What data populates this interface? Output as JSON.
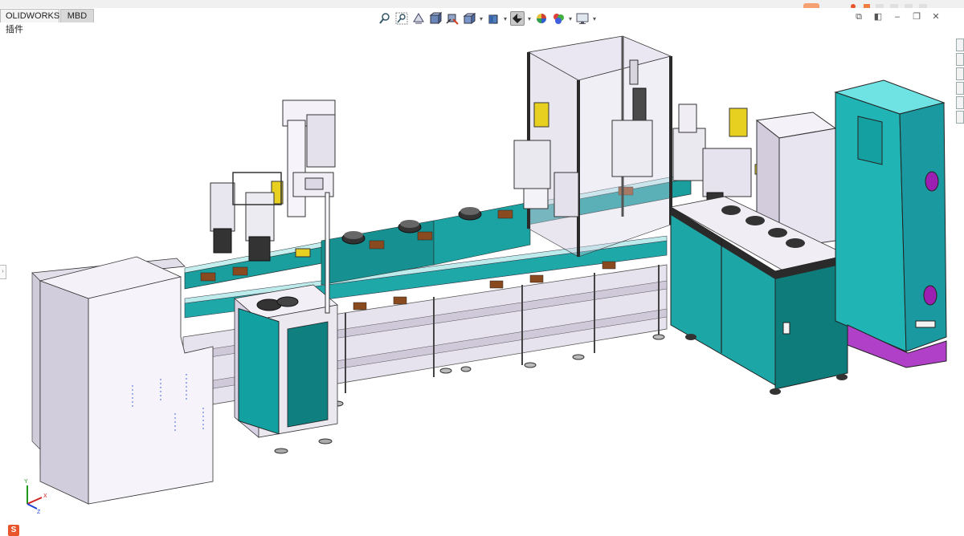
{
  "tabs": [
    {
      "label": "OLIDWORKS 插件",
      "active": false
    },
    {
      "label": "MBD",
      "active": true
    }
  ],
  "hud_toolbar": {
    "items": [
      {
        "icon": "zoom-to-fit-icon"
      },
      {
        "icon": "zoom-to-area-icon"
      },
      {
        "icon": "previous-view-icon"
      },
      {
        "icon": "section-view-icon"
      },
      {
        "icon": "dynamic-annotation-icon"
      },
      {
        "icon": "view-orientation-icon"
      },
      {
        "icon": "display-style-icon",
        "pressed": true
      },
      {
        "icon": "hide-show-items-icon"
      },
      {
        "icon": "edit-appearance-icon"
      },
      {
        "icon": "apply-scene-icon"
      },
      {
        "icon": "view-settings-icon"
      }
    ]
  },
  "colors": {
    "accent_teal": "#18a8a8",
    "frame_lavender": "#d8d2e4",
    "panel_white": "#f2f0f6",
    "cabinet_dark": "#2c3538",
    "magenta_base": "#b040c8",
    "motor_yellow": "#e8d020"
  },
  "triad": {
    "x_label": "X",
    "y_label": "Y",
    "z_label": "Z"
  }
}
